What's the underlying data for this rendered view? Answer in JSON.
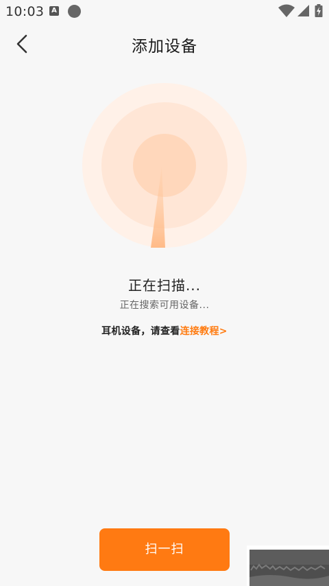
{
  "status_bar": {
    "time": "10:03",
    "notification_letter": "A"
  },
  "header": {
    "title": "添加设备"
  },
  "scan": {
    "title": "正在扫描...",
    "subtitle": "正在搜索可用设备...",
    "hint_prefix": "耳机设备，请查看",
    "hint_link": "连接教程>"
  },
  "actions": {
    "scan_button_label": "扫一扫"
  },
  "colors": {
    "accent": "#ff7a12",
    "link": "#ff7c12",
    "radar_outer": "#fff1e8",
    "radar_middle": "#ffe7d8",
    "radar_inner": "#ffd8bd"
  },
  "icons": {
    "back": "chevron-left-icon",
    "wifi": "wifi-icon",
    "signal": "signal-icon",
    "battery": "battery-charging-icon"
  }
}
